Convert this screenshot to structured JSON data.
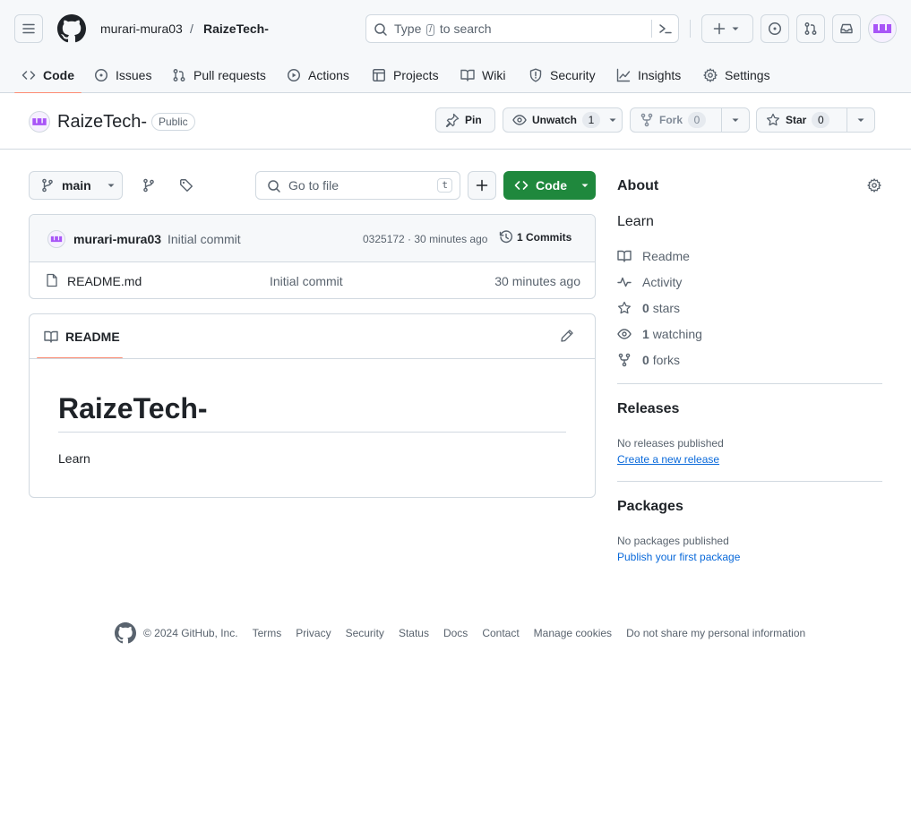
{
  "header": {
    "owner": "murari-mura03",
    "separator": "/",
    "repo": "RaizeTech-",
    "search_prefix": "Type",
    "search_key": "/",
    "search_suffix": "to search"
  },
  "nav": {
    "tabs": [
      {
        "label": "Code",
        "icon": "code-icon",
        "selected": true
      },
      {
        "label": "Issues",
        "icon": "issue-icon"
      },
      {
        "label": "Pull requests",
        "icon": "pull-request-icon"
      },
      {
        "label": "Actions",
        "icon": "play-icon"
      },
      {
        "label": "Projects",
        "icon": "table-icon"
      },
      {
        "label": "Wiki",
        "icon": "book-icon"
      },
      {
        "label": "Security",
        "icon": "shield-icon"
      },
      {
        "label": "Insights",
        "icon": "graph-icon"
      },
      {
        "label": "Settings",
        "icon": "gear-icon"
      }
    ]
  },
  "repo": {
    "name": "RaizeTech-",
    "visibility": "Public",
    "pin_label": "Pin",
    "watch_label": "Unwatch",
    "watch_count": "1",
    "fork_label": "Fork",
    "fork_count": "0",
    "star_label": "Star",
    "star_count": "0"
  },
  "toolbar": {
    "branch": "main",
    "go_to_file": "Go to file",
    "go_to_file_key": "t",
    "code_label": "Code"
  },
  "commit": {
    "author": "murari-mura03",
    "message": "Initial commit",
    "meta": "0325172 · 30 minutes ago",
    "history": "1 Commits"
  },
  "files": [
    {
      "name": "README.md",
      "message": "Initial commit",
      "age": "30 minutes ago"
    }
  ],
  "readme": {
    "tab_label": "README",
    "heading": "RaizeTech-",
    "body": "Learn"
  },
  "sidebar": {
    "about_title": "About",
    "description": "Learn",
    "items": [
      {
        "icon": "book-icon",
        "strong": "",
        "label": "Readme"
      },
      {
        "icon": "pulse-icon",
        "strong": "",
        "label": "Activity"
      },
      {
        "icon": "star-icon",
        "strong": "0",
        "label": "stars"
      },
      {
        "icon": "eye-icon",
        "strong": "1",
        "label": "watching"
      },
      {
        "icon": "fork-icon",
        "strong": "0",
        "label": "forks"
      }
    ],
    "releases_title": "Releases",
    "releases_empty": "No releases published",
    "releases_link": "Create a new release",
    "packages_title": "Packages",
    "packages_empty": "No packages published",
    "packages_link": "Publish your first package"
  },
  "footer": {
    "copyright": "© 2024 GitHub, Inc.",
    "links": [
      "Terms",
      "Privacy",
      "Security",
      "Status",
      "Docs",
      "Contact",
      "Manage cookies",
      "Do not share my personal information"
    ]
  }
}
